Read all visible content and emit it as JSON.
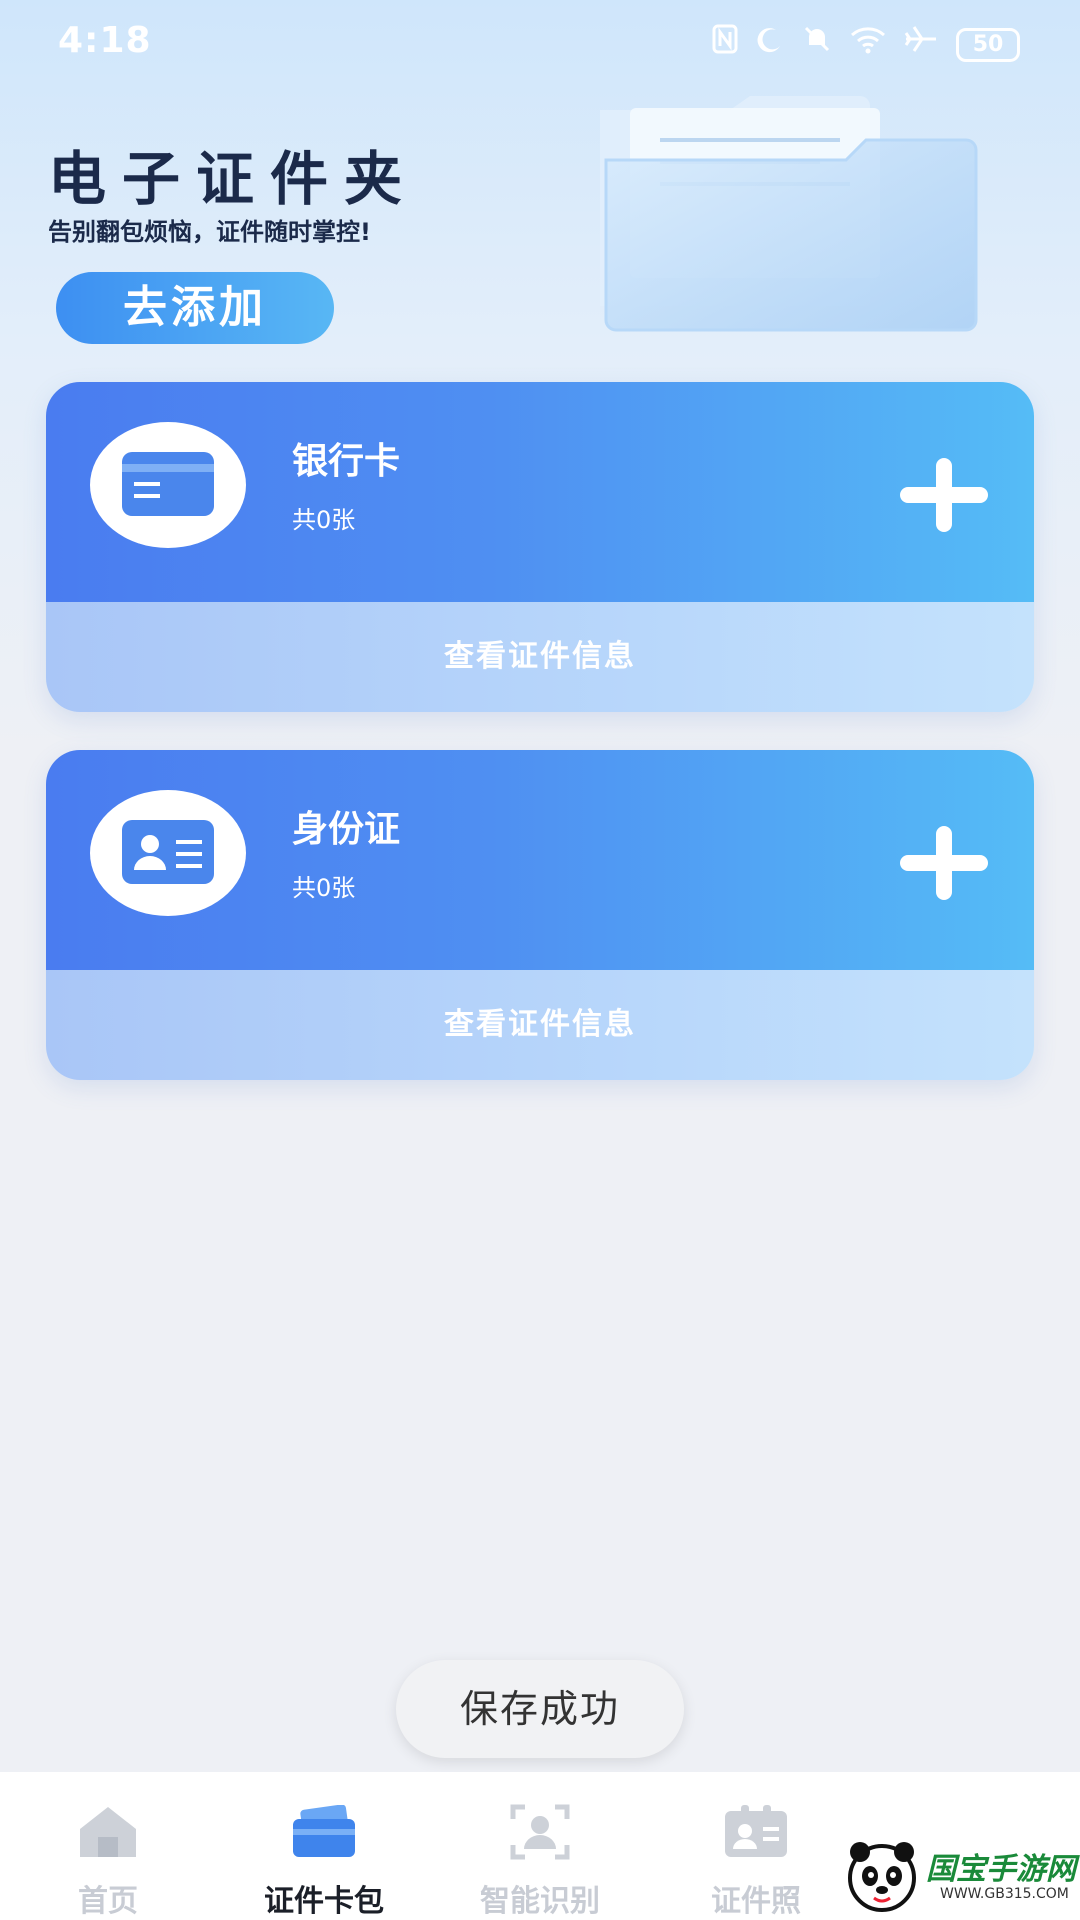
{
  "status_bar": {
    "time": "4:18",
    "battery": "50",
    "icons": [
      "nfc-icon",
      "moon-icon",
      "mute-icon",
      "wifi-icon",
      "airplane-icon"
    ]
  },
  "hero": {
    "title": "电子证件夹",
    "subtitle": "告别翻包烦恼，证件随时掌控!",
    "add_button": "去添加"
  },
  "cards": [
    {
      "name": "银行卡",
      "count": "共0张",
      "footer": "查看证件信息",
      "icon": "bank-card-icon"
    },
    {
      "name": "身份证",
      "count": "共0张",
      "footer": "查看证件信息",
      "icon": "id-card-icon"
    }
  ],
  "toast": "保存成功",
  "tabs": [
    {
      "label": "首页",
      "icon": "home-icon",
      "active": false
    },
    {
      "label": "证件卡包",
      "icon": "card-wallet-icon",
      "active": true
    },
    {
      "label": "智能识别",
      "icon": "scan-person-icon",
      "active": false
    },
    {
      "label": "证件照",
      "icon": "id-photo-icon",
      "active": false
    }
  ],
  "watermark": {
    "text": "国宝手游网",
    "url": "WWW.GB315.COM"
  },
  "colors": {
    "accent": "#4a7cf0",
    "accent_light": "#55bcf6",
    "title": "#1b2a4a"
  }
}
